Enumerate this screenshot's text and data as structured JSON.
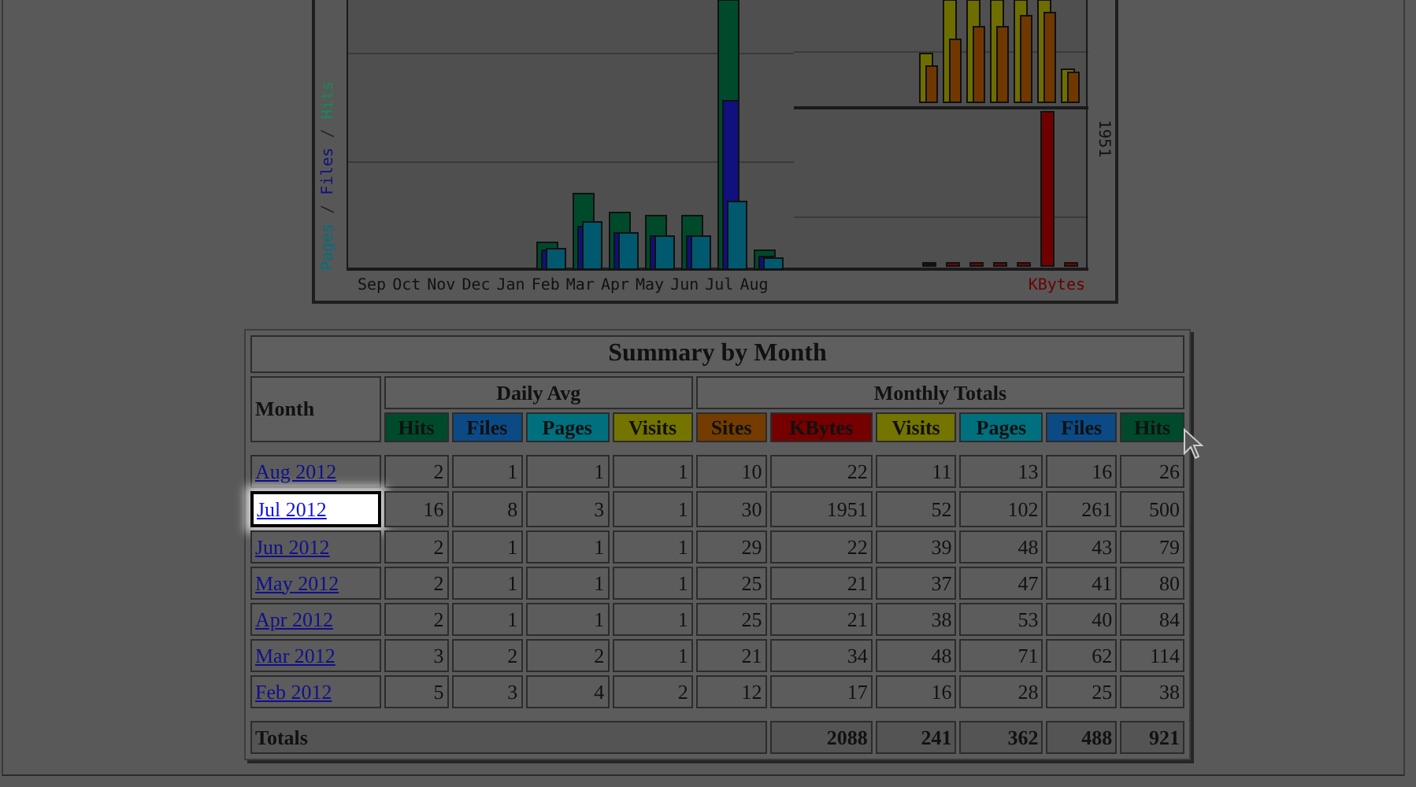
{
  "chart": {
    "axis_label": [
      {
        "text": "Pages",
        "color": "#00707e"
      },
      {
        "text": " / ",
        "color": "#222222"
      },
      {
        "text": "Files",
        "color": "#10107e"
      },
      {
        "text": " / ",
        "color": "#222222"
      },
      {
        "text": "Hits",
        "color": "#158a58"
      }
    ],
    "months": [
      "Sep",
      "Oct",
      "Nov",
      "Dec",
      "Jan",
      "Feb",
      "Mar",
      "Apr",
      "May",
      "Jun",
      "Jul",
      "Aug"
    ],
    "kbytes_label": "KBytes",
    "max_label": "1951"
  },
  "summary": {
    "title": "Summary by Month",
    "month_header": "Month",
    "groups": [
      {
        "label": "Daily Avg"
      },
      {
        "label": "Monthly Totals"
      }
    ],
    "columns": [
      {
        "label": "Hits",
        "color": "#004a2c"
      },
      {
        "label": "Files",
        "color": "#0c4a86"
      },
      {
        "label": "Pages",
        "color": "#00707e"
      },
      {
        "label": "Visits",
        "color": "#747400"
      },
      {
        "label": "Sites",
        "color": "#743c00"
      },
      {
        "label": "KBytes",
        "color": "#740000"
      },
      {
        "label": "Visits",
        "color": "#747400"
      },
      {
        "label": "Pages",
        "color": "#00707e"
      },
      {
        "label": "Files",
        "color": "#0c4a86"
      },
      {
        "label": "Hits",
        "color": "#004a2c"
      }
    ],
    "rows": [
      {
        "month": "Aug 2012",
        "selected": false,
        "values": [
          "2",
          "1",
          "1",
          "1",
          "10",
          "22",
          "11",
          "13",
          "16",
          "26"
        ]
      },
      {
        "month": "Jul 2012",
        "selected": true,
        "values": [
          "16",
          "8",
          "3",
          "1",
          "30",
          "1951",
          "52",
          "102",
          "261",
          "500"
        ]
      },
      {
        "month": "Jun 2012",
        "selected": false,
        "values": [
          "2",
          "1",
          "1",
          "1",
          "29",
          "22",
          "39",
          "48",
          "43",
          "79"
        ]
      },
      {
        "month": "May 2012",
        "selected": false,
        "values": [
          "2",
          "1",
          "1",
          "1",
          "25",
          "21",
          "37",
          "47",
          "41",
          "80"
        ]
      },
      {
        "month": "Apr 2012",
        "selected": false,
        "values": [
          "2",
          "1",
          "1",
          "1",
          "25",
          "21",
          "38",
          "53",
          "40",
          "84"
        ]
      },
      {
        "month": "Mar 2012",
        "selected": false,
        "values": [
          "3",
          "2",
          "2",
          "1",
          "21",
          "34",
          "48",
          "71",
          "62",
          "114"
        ]
      },
      {
        "month": "Feb 2012",
        "selected": false,
        "values": [
          "5",
          "3",
          "4",
          "2",
          "12",
          "17",
          "16",
          "28",
          "25",
          "38"
        ]
      }
    ],
    "totals": {
      "label": "Totals",
      "values": [
        "2088",
        "241",
        "362",
        "488",
        "921"
      ]
    }
  }
}
